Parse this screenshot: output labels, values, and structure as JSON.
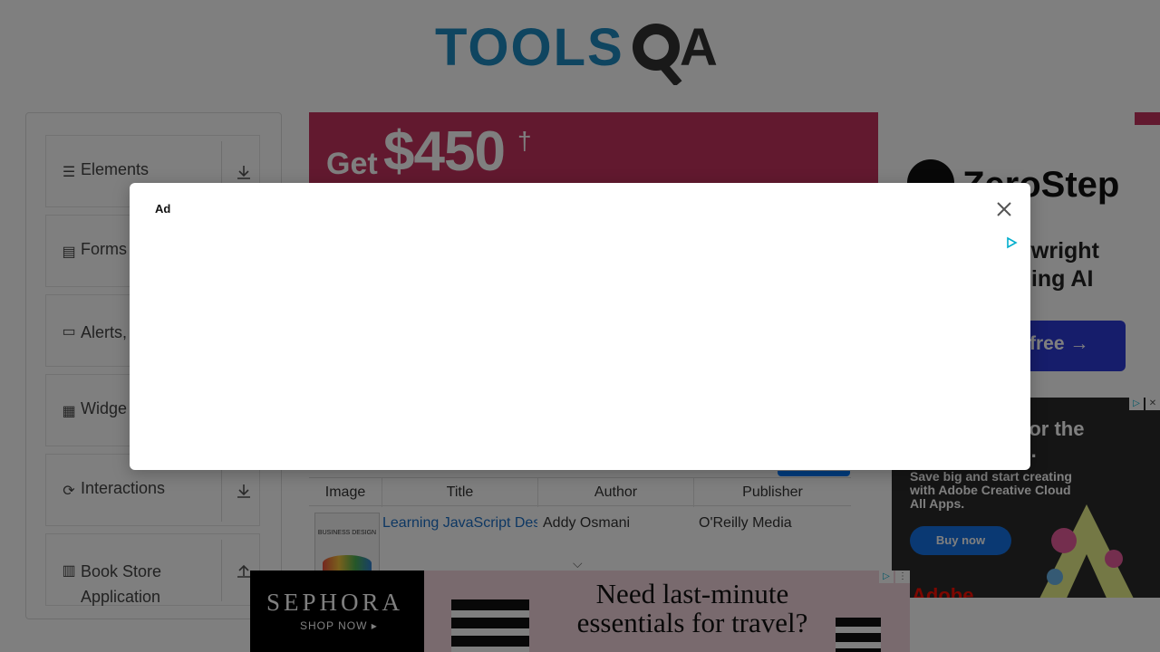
{
  "header": {
    "logo_text": "TOOLSQA"
  },
  "sidebar": {
    "groups": [
      {
        "label": "Elements",
        "icon": "hamburger-icon",
        "arrow": "download-arrow-icon"
      },
      {
        "label": "Forms",
        "icon": "document-icon"
      },
      {
        "label": "Alerts, Frame & Windows",
        "label_visible": "Alerts, Windo",
        "icon": "window-icon"
      },
      {
        "label": "Widgets",
        "label_visible": "Widge",
        "icon": "widgets-icon"
      },
      {
        "label": "Interactions",
        "icon": "refresh-icon",
        "arrow": "download-arrow-icon"
      },
      {
        "label": "Book Store Application",
        "icon": "books-icon",
        "arrow": "upload-arrow-icon"
      }
    ]
  },
  "promo": {
    "prefix": "Get",
    "amount": "$450",
    "mark": "†"
  },
  "table": {
    "headers": [
      "Image",
      "Title",
      "Author",
      "Publisher"
    ],
    "rows": [
      {
        "title": "Learning JavaScript Desi",
        "author": "Addy Osmani",
        "publisher": "O'Reilly Media",
        "thumb_text": "BUSINESS DESIGN"
      }
    ]
  },
  "right_ad": {
    "brand": "ZeroStep",
    "text_line1": "ywright",
    "text_line2": "sing AI",
    "button_label": "free →"
  },
  "adobe_ad": {
    "heading1": "for the",
    "heading2": "ns.",
    "body": "Save big and start creating with Adobe Creative Cloud All Apps.",
    "button_label": "Buy now",
    "brand": "Adobe"
  },
  "bottom_ad": {
    "brand": "SEPHORA",
    "cta": "SHOP NOW ▸",
    "headline": "Need last-minute essentials for travel?"
  },
  "modal": {
    "label": "Ad",
    "close_icon": "close-icon",
    "adchoices_icon": "adchoices-icon"
  },
  "colors": {
    "promo": "#c4325f",
    "link": "#1b6fc6",
    "overlay": "rgba(0,0,0,0.5)"
  }
}
